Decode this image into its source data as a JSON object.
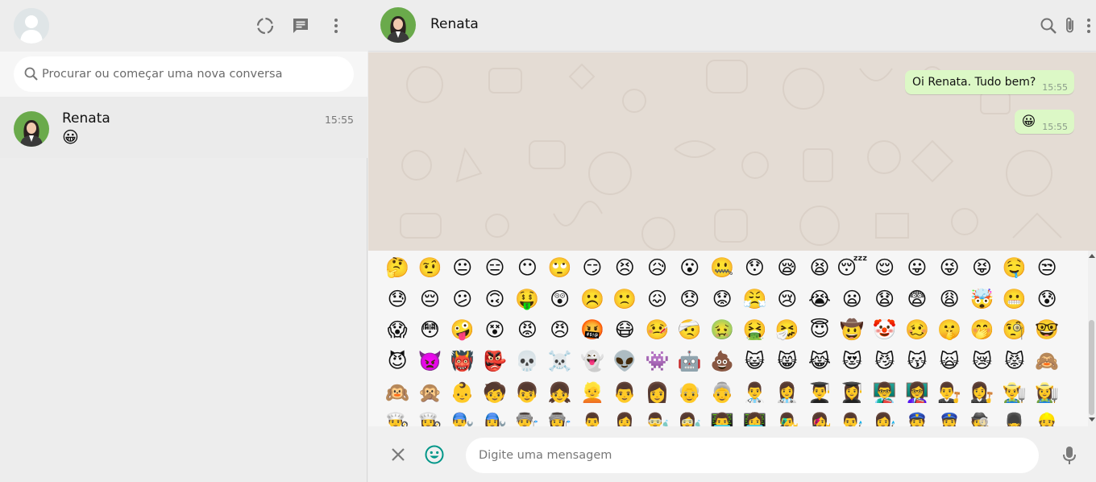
{
  "colors": {
    "panel_bg": "#ededed",
    "outgoing_bubble": "#dcf8c6",
    "chat_wallpaper": "#e4dcd4",
    "accent_icon": "#009688"
  },
  "left_header": {
    "icons": [
      "status-icon",
      "new-chat-icon",
      "menu-icon"
    ]
  },
  "search": {
    "placeholder": "Procurar ou começar uma nova conversa"
  },
  "chats": [
    {
      "name": "Renata",
      "time": "15:55",
      "preview": "😀"
    }
  ],
  "conversation": {
    "contact_name": "Renata",
    "header_icons": [
      "search-icon",
      "attach-icon",
      "menu-icon"
    ],
    "messages": [
      {
        "text": "Oi Renata. Tudo bem?",
        "time": "15:55",
        "direction": "outgoing"
      },
      {
        "text": "😀",
        "time": "15:55",
        "direction": "outgoing"
      }
    ]
  },
  "emoji_panel": {
    "emojis": [
      "🤔",
      "🤨",
      "😐",
      "😑",
      "😶",
      "🙄",
      "😏",
      "😣",
      "😥",
      "😮",
      "🤐",
      "😯",
      "😪",
      "😫",
      "😴",
      "😌",
      "😛",
      "😜",
      "😝",
      "🤤",
      "😒",
      "😓",
      "😔",
      "😕",
      "🙃",
      "🤑",
      "😲",
      "☹️",
      "🙁",
      "😖",
      "😞",
      "😟",
      "😤",
      "😢",
      "😭",
      "😦",
      "😧",
      "😨",
      "😩",
      "🤯",
      "😬",
      "😰",
      "😱",
      "😳",
      "🤪",
      "😵",
      "😡",
      "😠",
      "🤬",
      "😷",
      "🤒",
      "🤕",
      "🤢",
      "🤮",
      "🤧",
      "😇",
      "🤠",
      "🤡",
      "🥴",
      "🤫",
      "🤭",
      "🧐",
      "🤓",
      "😈",
      "👿",
      "👹",
      "👺",
      "💀",
      "☠️",
      "👻",
      "👽",
      "👾",
      "🤖",
      "💩",
      "😺",
      "😸",
      "😹",
      "😻",
      "😼",
      "😽",
      "🙀",
      "😿",
      "😾",
      "🙈",
      "🙉",
      "🙊",
      "👶",
      "🧒",
      "👦",
      "👧",
      "👱",
      "👨",
      "👩",
      "👴",
      "👵",
      "👨‍⚕️",
      "👩‍⚕️",
      "👨‍🎓",
      "👩‍🎓",
      "👨‍🏫",
      "👩‍🏫",
      "👨‍⚖️",
      "👩‍⚖️",
      "👨‍🌾",
      "👩‍🌾",
      "👨‍🍳",
      "👩‍🍳",
      "👨‍🔧",
      "👩‍🔧",
      "👨‍🏭",
      "👩‍🏭",
      "👨‍💼",
      "👩‍💼",
      "👨‍🔬",
      "👩‍🔬",
      "👨‍💻",
      "👩‍💻",
      "👨‍🎤",
      "👩‍🎤",
      "👨‍🎨",
      "👩‍🎨",
      "👮",
      "👮‍♀️",
      "🕵️",
      "💂",
      "👷"
    ]
  },
  "composer": {
    "placeholder": "Digite uma mensagem",
    "icons": [
      "close-icon",
      "emoji-icon",
      "mic-icon"
    ]
  }
}
